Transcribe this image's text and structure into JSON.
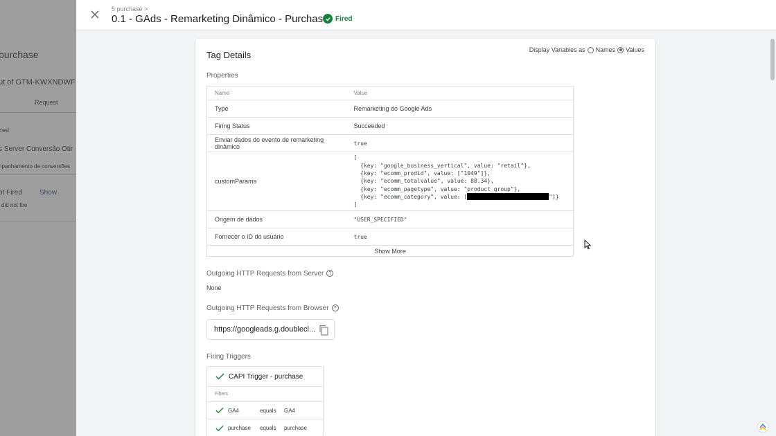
{
  "background": {
    "lines": [
      "purchase",
      "ut of GTM-KWXNDWF",
      "Request",
      "ired",
      "s Server Conversão Otir",
      "npanhamento de conversões",
      "ot Fired",
      "Show",
      "did not fire"
    ]
  },
  "header": {
    "breadcrumb": "5 purchase >",
    "title": "0.1 - GAds - Remarketing Dinâmico - Purchase",
    "status": "Fired"
  },
  "card": {
    "title": "Tag Details",
    "display_variables_label": "Display Variables as",
    "option_names": "Names",
    "option_values": "Values",
    "selected_option": "Values"
  },
  "properties": {
    "label": "Properties",
    "col_name": "Name",
    "col_value": "Value",
    "rows": [
      {
        "name": "Type",
        "value": "Remarketing do Google Ads"
      },
      {
        "name": "Firing Status",
        "value": "Succeeded"
      },
      {
        "name": "Enviar dados do evento de remarketing dinâmico",
        "value": "true"
      },
      {
        "name": "customParams",
        "value": ""
      },
      {
        "name": "Origem de dados",
        "value": "\"USER_SPECIFIED\""
      },
      {
        "name": "Fornecer o ID do usuário",
        "value": "true"
      }
    ],
    "custom_params_lines": [
      "[",
      "  {key: \"google_business_vertical\", value: \"retail\"},",
      "  {key: \"ecomm_prodid\", value: [\"1049\"]},",
      "  {key: \"ecomm_totalvalue\", value: 88.34},",
      "  {key: \"ecomm_pagetype\", value: \"product_group\"},",
      "  {key: \"ecomm_category\", value: [",
      "]"
    ],
    "custom_params_tail": "\"]}",
    "show_more": "Show More"
  },
  "outgoing_server": {
    "label": "Outgoing HTTP Requests from Server",
    "value": "None"
  },
  "outgoing_browser": {
    "label": "Outgoing HTTP Requests from Browser",
    "url": "https://googleads.g.doublecl..."
  },
  "firing_triggers": {
    "label": "Firing Triggers",
    "trigger_name": "CAPI Trigger - purchase",
    "filters_label": "Filters",
    "filters": [
      {
        "variable": "GA4",
        "operator": "equals",
        "value": "GA4"
      },
      {
        "variable": "purchase",
        "operator": "equals",
        "value": "purchase"
      }
    ]
  },
  "colors": {
    "fired_green": "#188038",
    "code_string": "#b31412"
  }
}
